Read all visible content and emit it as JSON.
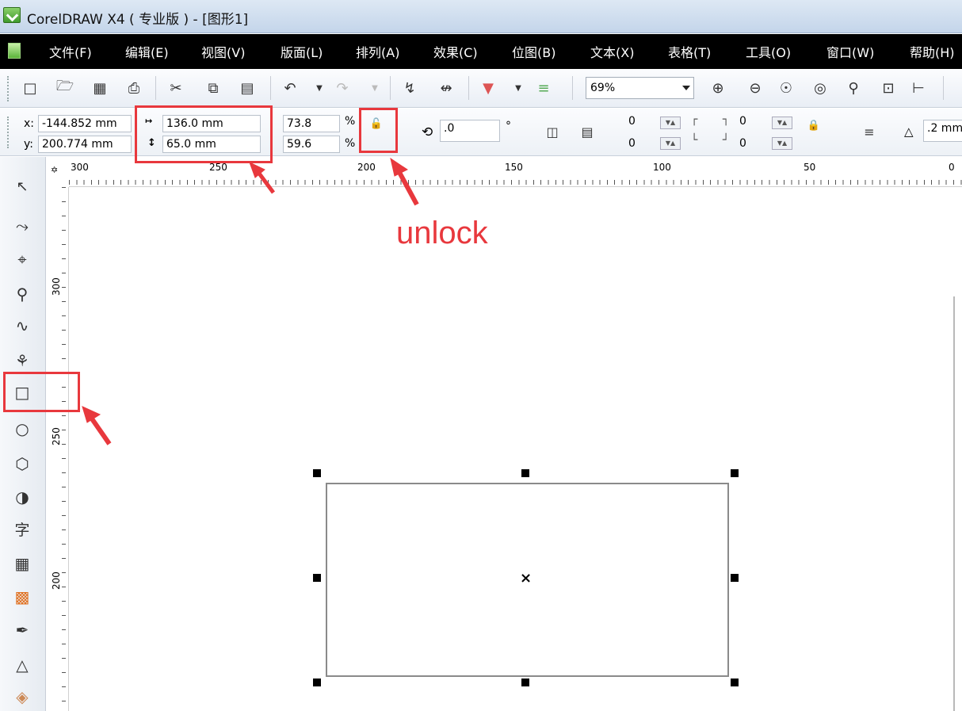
{
  "window": {
    "title": "CorelDRAW X4 ( 专业版 ) - [图形1]"
  },
  "menu": [
    "文件(F)",
    "编辑(E)",
    "视图(V)",
    "版面(L)",
    "排列(A)",
    "效果(C)",
    "位图(B)",
    "文本(X)",
    "表格(T)",
    "工具(O)",
    "窗口(W)",
    "帮助(H)"
  ],
  "toolbar": {
    "zoom": "69%",
    "icons": [
      "new-icon",
      "open-icon",
      "save-icon",
      "print-icon",
      "cut-icon",
      "copy-icon",
      "paste-icon",
      "undo-icon",
      "redo-icon",
      "import-icon",
      "export-icon",
      "application-launcher-icon",
      "welcome-screen-icon",
      "zoom-in-icon",
      "zoom-out-icon",
      "zoom-selection-icon",
      "zoom-all-icon",
      "zoom-page-icon",
      "zoom-width-icon",
      "zoom-height-icon"
    ]
  },
  "properties": {
    "x_label": "x:",
    "x_value": "-144.852 mm",
    "y_label": "y:",
    "y_value": "200.774 mm",
    "width": "136.0 mm",
    "height": "65.0 mm",
    "scale_x": "73.8",
    "scale_y": "59.6",
    "percent": "%",
    "rotation": ".0",
    "degree": "°",
    "corner_tl": "0",
    "corner_bl": "0",
    "corner_tr": "0",
    "corner_br": "0",
    "outline_width": ".2 mm"
  },
  "ruler": {
    "top": [
      "300",
      "250",
      "200",
      "150",
      "100",
      "50",
      "0"
    ],
    "left": [
      "300",
      "250",
      "200"
    ]
  },
  "annotation": {
    "text": "unlock",
    "color": "#e8383d"
  }
}
